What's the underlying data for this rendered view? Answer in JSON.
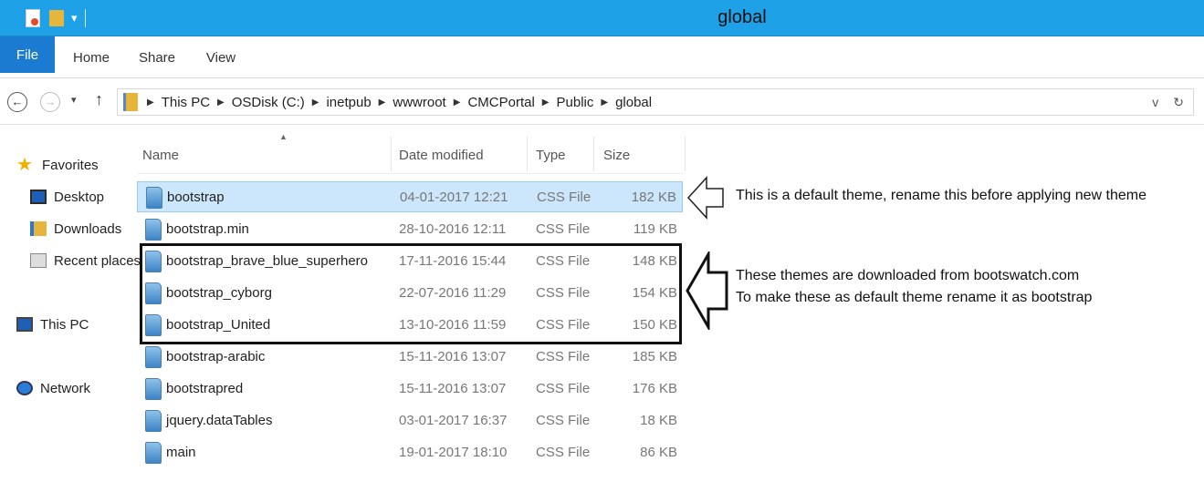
{
  "window": {
    "title": "global"
  },
  "ribbon": {
    "tabs": [
      "File",
      "Home",
      "Share",
      "View"
    ],
    "expand_icon": "chevron-down-icon"
  },
  "address": {
    "crumbs": [
      "This PC",
      "OSDisk (C:)",
      "inetpub",
      "wwwroot",
      "CMCPortal",
      "Public",
      "global"
    ],
    "dropdown_glyph": "v",
    "refresh_glyph": "↻"
  },
  "nav_pane": {
    "favorites": "Favorites",
    "desktop": "Desktop",
    "downloads": "Downloads",
    "recent": "Recent places",
    "this_pc": "This PC",
    "network": "Network"
  },
  "columns": {
    "name": "Name",
    "date": "Date modified",
    "type": "Type",
    "size": "Size"
  },
  "files": [
    {
      "name": "bootstrap",
      "date": "04-01-2017 12:21",
      "type": "CSS File",
      "size": "182 KB"
    },
    {
      "name": "bootstrap.min",
      "date": "28-10-2016 12:11",
      "type": "CSS File",
      "size": "119 KB"
    },
    {
      "name": "bootstrap_brave_blue_superhero",
      "date": "17-11-2016 15:44",
      "type": "CSS File",
      "size": "148 KB"
    },
    {
      "name": "bootstrap_cyborg",
      "date": "22-07-2016 11:29",
      "type": "CSS File",
      "size": "154 KB"
    },
    {
      "name": "bootstrap_United",
      "date": "13-10-2016 11:59",
      "type": "CSS File",
      "size": "150 KB"
    },
    {
      "name": "bootstrap-arabic",
      "date": "15-11-2016 13:07",
      "type": "CSS File",
      "size": "185 KB"
    },
    {
      "name": "bootstrapred",
      "date": "15-11-2016 13:07",
      "type": "CSS File",
      "size": "176 KB"
    },
    {
      "name": "jquery.dataTables",
      "date": "03-01-2017 16:37",
      "type": "CSS File",
      "size": "18 KB"
    },
    {
      "name": "main",
      "date": "19-01-2017 18:10",
      "type": "CSS File",
      "size": "86 KB"
    }
  ],
  "annotations": {
    "note1": "This is a default theme, rename this before applying new theme",
    "note2_line1": "These themes are downloaded from bootswatch.com",
    "note2_line2": "To make these as default theme rename it as bootstrap"
  }
}
